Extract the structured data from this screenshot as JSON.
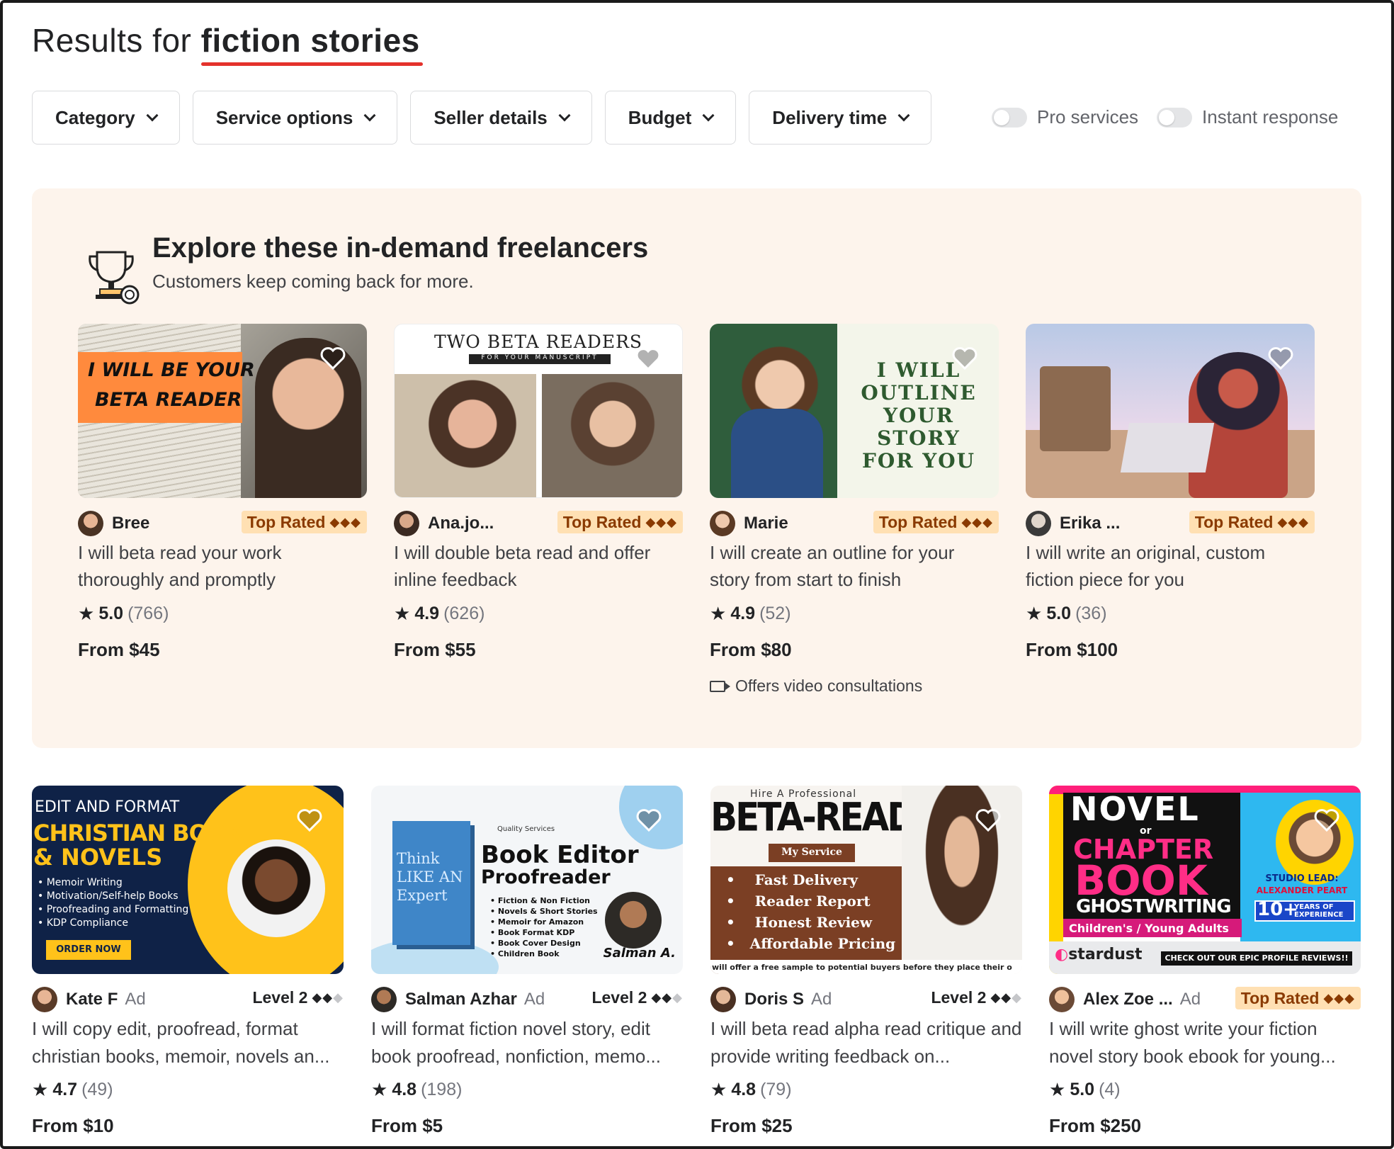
{
  "header": {
    "prefix": "Results for",
    "query": "fiction stories"
  },
  "filters": [
    {
      "label": "Category"
    },
    {
      "label": "Service options"
    },
    {
      "label": "Seller details"
    },
    {
      "label": "Budget"
    },
    {
      "label": "Delivery time"
    }
  ],
  "toggles": {
    "pro": "Pro services",
    "instant": "Instant response"
  },
  "promo": {
    "title": "Explore these in-demand freelancers",
    "subtitle": "Customers keep coming back for more.",
    "cards": [
      {
        "seller": "Bree",
        "badge": "Top Rated",
        "badge_icon": "◆◆◆",
        "title": "I will beta read your work thoroughly and promptly",
        "rating": "5.0",
        "reviews": "(766)",
        "price": "From $45",
        "thumb_lines": [
          "I WILL BE YOUR",
          "BETA READER"
        ]
      },
      {
        "seller": "Ana.jo...",
        "badge": "Top Rated",
        "badge_icon": "◆◆◆",
        "title": "I will double beta read and offer inline feedback",
        "rating": "4.9",
        "reviews": "(626)",
        "price": "From $55",
        "thumb_lines": [
          "TWO BETA READERS",
          "FOR YOUR MANUSCRIPT"
        ]
      },
      {
        "seller": "Marie",
        "badge": "Top Rated",
        "badge_icon": "◆◆◆",
        "title": "I will create an outline for your story from start to finish",
        "rating": "4.9",
        "reviews": "(52)",
        "price": "From $80",
        "extra": "Offers video consultations",
        "thumb_lines": [
          "I WILL",
          "OUTLINE",
          "YOUR",
          "STORY",
          "FOR YOU"
        ]
      },
      {
        "seller": "Erika ...",
        "badge": "Top Rated",
        "badge_icon": "◆◆◆",
        "title": "I will write an original, custom fiction piece for you",
        "rating": "5.0",
        "reviews": "(36)",
        "price": "From $100"
      }
    ]
  },
  "results": [
    {
      "seller": "Kate F",
      "ad": "Ad",
      "level": "Level 2",
      "level_icon_on": "◆◆",
      "level_icon_off": "◆",
      "title": "I will copy edit, proofread, format christian books, memoir, novels an...",
      "rating": "4.7",
      "reviews": "(49)",
      "price": "From $10",
      "thumb": {
        "top": "EDIT AND FORMAT",
        "head1": "CHRISTIAN BOOK",
        "head2": "& NOVELS",
        "bullets": [
          "Memoir Writing",
          "Motivation/Self-help Books",
          "Proofreading and Formatting",
          "KDP Compliance"
        ],
        "cta": "ORDER NOW"
      }
    },
    {
      "seller": "Salman Azhar",
      "ad": "Ad",
      "level": "Level 2",
      "level_icon_on": "◆◆",
      "level_icon_off": "◆",
      "title": "I will format fiction novel story, edit book proofread, nonfiction, memo...",
      "rating": "4.8",
      "reviews": "(198)",
      "price": "From $5",
      "thumb": {
        "small": "Quality Services",
        "head1": "Book Editor",
        "head2": "Proofreader",
        "book": "Think LIKE AN Expert",
        "bullets": [
          "Fiction & Non Fiction",
          "Novels & Short Stories",
          "Memoir for Amazon",
          "Book Format KDP",
          "Book Cover Design",
          "Children Book"
        ],
        "sign": "Salman A."
      }
    },
    {
      "seller": "Doris S",
      "ad": "Ad",
      "level": "Level 2",
      "level_icon_on": "◆◆",
      "level_icon_off": "◆",
      "title": "I will beta read alpha read critique and provide writing feedback on...",
      "rating": "4.8",
      "reviews": "(79)",
      "price": "From $25",
      "thumb": {
        "small": "Hire A Professional",
        "head": "BETA-READER",
        "pill": "My Service",
        "bullets": [
          "Fast Delivery",
          "Reader Report",
          "Honest Review",
          "Affordable Pricing"
        ],
        "foot": "will offer a free sample to potential buyers before they place their o"
      }
    },
    {
      "seller": "Alex Zoe ...",
      "ad": "Ad",
      "badge": "Top Rated",
      "badge_icon": "◆◆◆",
      "title": "I will write ghost write your fiction novel story book ebook for young...",
      "rating": "5.0",
      "reviews": "(4)",
      "price": "From $250",
      "thumb": {
        "l1": "NOVEL",
        "l2": "or",
        "l3": "CHAPTER",
        "l4": "BOOK",
        "l5": "GHOSTWRITING",
        "l6": "Children's / Young Adults",
        "lead1": "STUDIO LEAD:",
        "lead2": "ALEXANDER PEART",
        "years": "10+",
        "years_txt": "YEARS OF EXPERIENCE",
        "brand": "stardust",
        "reviews_banner": "CHECK OUT OUR EPIC PROFILE REVIEWS!!"
      }
    }
  ]
}
